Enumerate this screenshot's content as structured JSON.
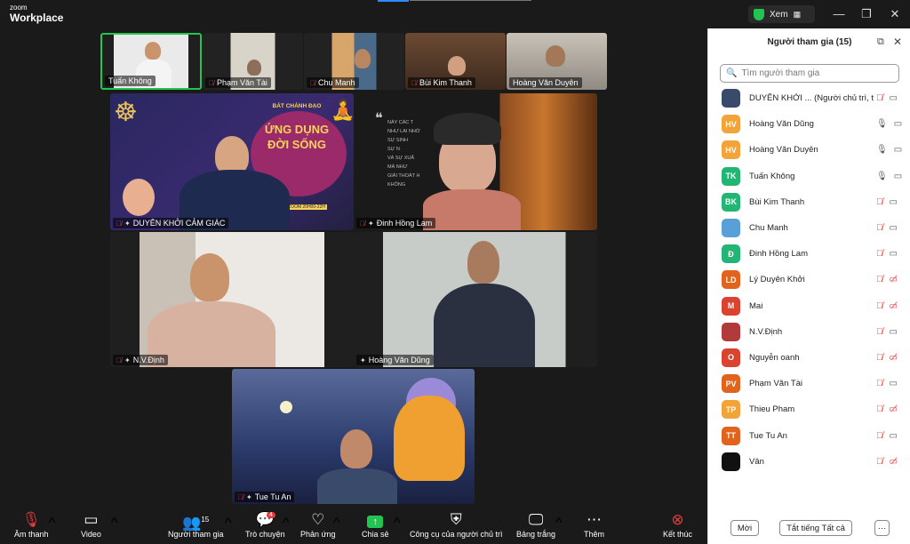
{
  "titlebar": {
    "logo_small": "zoom",
    "logo_big": "Workplace",
    "view_label": "Xem",
    "minimize": "—",
    "restore": "❐",
    "close": "✕"
  },
  "tiles": {
    "top": [
      {
        "name": "Tuấn Không"
      },
      {
        "name": "Phạm Văn Tài"
      },
      {
        "name": "Chu Manh"
      },
      {
        "name": "Bùi Kim Thanh"
      },
      {
        "name": "Hoàng Văn Duyên"
      }
    ],
    "main": [
      {
        "name": "DUYÊN KHỞI CẢM GIÁC",
        "poster_line1": "BÁT CHÁNH ĐẠO",
        "poster_line2": "ỨNG DỤNG",
        "poster_line3": "ĐỜI SỐNG",
        "poster_footer": "ZOOM 20H00-22H"
      },
      {
        "name": "Đinh Hồng Lam",
        "quote_lines": [
          "NÀY CÁC T",
          "NHƯ LAI NHỜ",
          "SỰ SINH",
          "SỰ N",
          "VÀ SỰ XUẤ",
          "MÀ NHƯ",
          "GIẢI THOÁT H",
          "KHÔNG"
        ]
      },
      {
        "name": "N.V.Định"
      },
      {
        "name": "Hoàng Văn Dũng"
      },
      {
        "name": "Tue Tu An"
      }
    ]
  },
  "toolbar": {
    "audio": "Âm thanh",
    "video": "Video",
    "participants": "Người tham gia",
    "participants_count": "15",
    "chat": "Trò chuyện",
    "chat_badge": "4",
    "react": "Phản ứng",
    "share": "Chia sẻ",
    "host_tools": "Công cụ của người chủ trì",
    "whiteboard": "Bảng trắng",
    "more": "Thêm",
    "end": "Kết thúc"
  },
  "panel": {
    "title": "Người tham gia (15)",
    "search_placeholder": "Tìm người tham gia",
    "participants": [
      {
        "name": "DUYÊN KHỞI ...  (Người chủ trì, tôi)",
        "initials": "",
        "color": "#3a4a6a",
        "mic": "off",
        "cam": "on"
      },
      {
        "name": "Hoàng Văn Dũng",
        "initials": "HV",
        "color": "#f2a33a",
        "mic": "on",
        "cam": "on"
      },
      {
        "name": "Hoàng Văn Duyên",
        "initials": "HV",
        "color": "#f2a33a",
        "mic": "on",
        "cam": "on"
      },
      {
        "name": "Tuấn Không",
        "initials": "TK",
        "color": "#22b573",
        "mic": "on",
        "cam": "on"
      },
      {
        "name": "Bùi Kim Thanh",
        "initials": "BK",
        "color": "#22b573",
        "mic": "off",
        "cam": "on"
      },
      {
        "name": "Chu Manh",
        "initials": "",
        "color": "#5aa0d8",
        "mic": "off",
        "cam": "on"
      },
      {
        "name": "Đinh Hồng Lam",
        "initials": "Đ",
        "color": "#22b573",
        "mic": "off",
        "cam": "on"
      },
      {
        "name": "Lý Duyên Khởi",
        "initials": "LD",
        "color": "#e0641e",
        "mic": "off",
        "cam": "off"
      },
      {
        "name": "Mai",
        "initials": "M",
        "color": "#d9432f",
        "mic": "off",
        "cam": "off"
      },
      {
        "name": "N.V.Định",
        "initials": "",
        "color": "#b23a3a",
        "mic": "off",
        "cam": "on"
      },
      {
        "name": "Nguyễn oanh",
        "initials": "O",
        "color": "#d9432f",
        "mic": "off",
        "cam": "off"
      },
      {
        "name": "Phạm Văn Tài",
        "initials": "PV",
        "color": "#e0641e",
        "mic": "off",
        "cam": "on"
      },
      {
        "name": "Thieu Pham",
        "initials": "TP",
        "color": "#f2a33a",
        "mic": "off",
        "cam": "off"
      },
      {
        "name": "Tue Tu An",
        "initials": "TT",
        "color": "#e0641e",
        "mic": "off",
        "cam": "on"
      },
      {
        "name": "Vân",
        "initials": "",
        "color": "#111111",
        "mic": "off",
        "cam": "off"
      }
    ],
    "invite_btn": "Mời",
    "mute_all_btn": "Tắt tiếng Tất cả",
    "more_btn": "···"
  }
}
